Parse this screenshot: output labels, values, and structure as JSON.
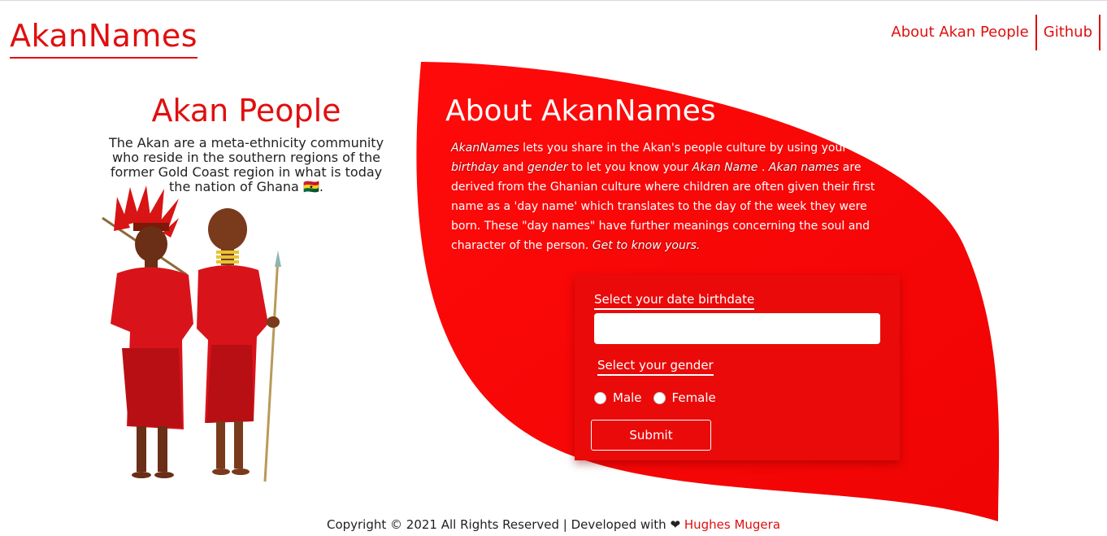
{
  "header": {
    "brand": "AkanNames",
    "nav": [
      {
        "label": "About Akan People"
      },
      {
        "label": "Github"
      }
    ]
  },
  "left": {
    "title": "Akan People",
    "description": "The Akan are a meta-ethnicity community who reside in the southern regions of the former Gold Coast region in what is today the nation of Ghana 🇬🇭."
  },
  "about": {
    "title": "About AkanNames",
    "p1_em1": "AkanNames",
    "p1_t1": " lets you share in the Akan's people culture by using your ",
    "p1_em2": "birthday",
    "p1_t2": " and ",
    "p1_em3": "gender",
    "p1_t3": " to let you know your ",
    "p1_em4": "Akan Name",
    "p1_t4": " . ",
    "p2_em1": "Akan names",
    "p2_t1": " are derived from the Ghanian culture where children are often given their first name as a 'day name' which translates to the day of the week they were born. These \"day names\" have further meanings concerning the soul and character of the person. ",
    "p2_em2": "Get to know yours."
  },
  "form": {
    "date_label": "Select your date birthdate",
    "date_value": "",
    "gender_label": "Select your gender",
    "options": [
      "Male",
      "Female"
    ],
    "submit_label": "Submit"
  },
  "footer": {
    "text": "Copyright © 2021 All Rights Reserved | Developed with",
    "heart": "❤",
    "author": "Hughes Mugera"
  },
  "colors": {
    "accent": "#e00f0f",
    "form_bg": "#ea0a0a"
  },
  "icons": [
    "calendar-icon",
    "heart-icon"
  ]
}
